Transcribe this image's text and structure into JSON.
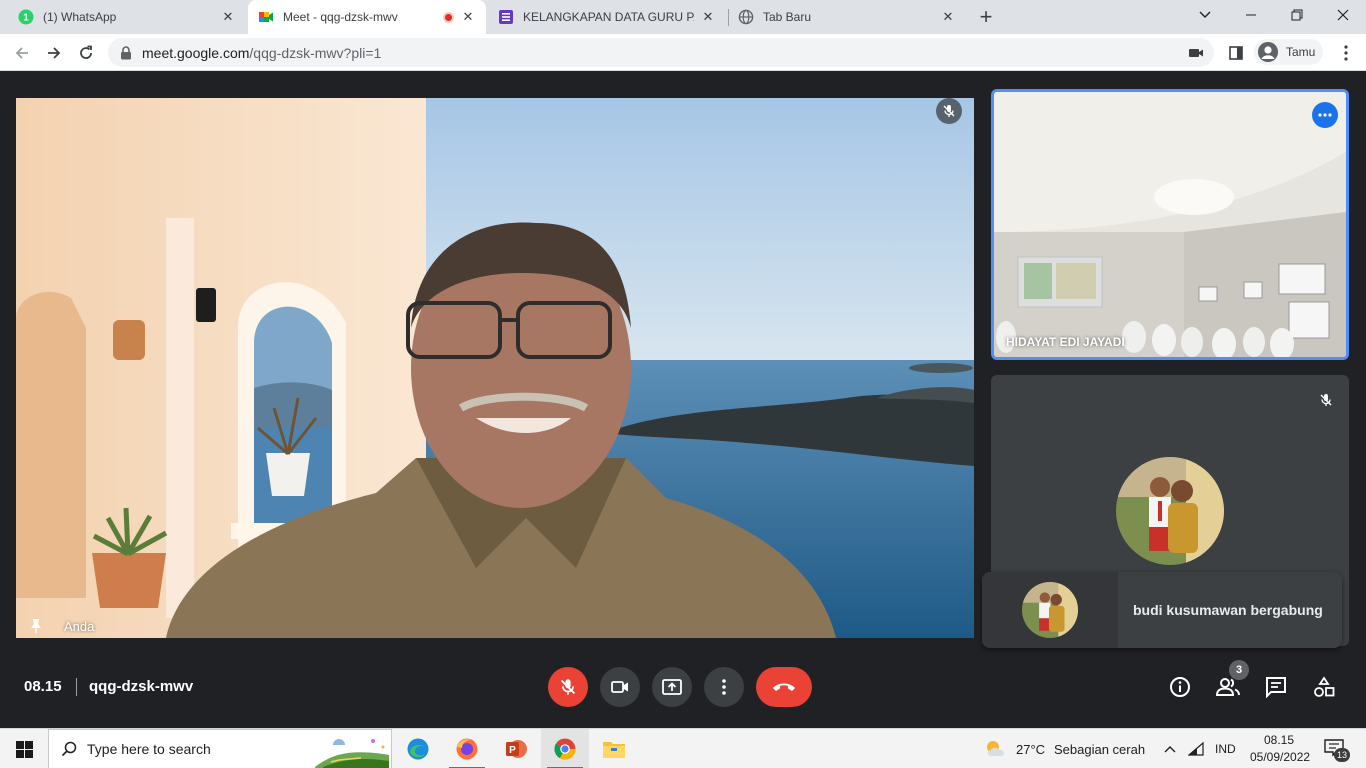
{
  "browser": {
    "tabs": [
      {
        "title": "(1) WhatsApp",
        "badge": "1",
        "icon": "whatsapp-icon"
      },
      {
        "title": "Meet - qqg-dzsk-mwv",
        "icon": "google-meet-icon",
        "recording": true
      },
      {
        "title": "KELANGKAPAN DATA GURU PAMO",
        "icon": "google-forms-icon"
      },
      {
        "title": "Tab Baru",
        "icon": "globe-icon"
      }
    ],
    "url_host": "meet.google.com",
    "url_path": "/qqg-dzsk-mwv?pli=1",
    "profile_label": "Tamu"
  },
  "meet": {
    "self_label": "Anda",
    "participants": [
      {
        "name": "HIDAYAT EDI JAYADI"
      },
      {
        "name": ""
      }
    ],
    "notification": "budi kusumawan bergabung",
    "time": "08.15",
    "meeting_code": "qqg-dzsk-mwv",
    "people_count": "3",
    "colors": {
      "accent": "#1a73e8",
      "danger": "#ea4335",
      "surface": "#3c4043",
      "background": "#202124"
    }
  },
  "taskbar": {
    "search_placeholder": "Type here to search",
    "weather_temp": "27°C",
    "weather_desc": "Sebagian cerah",
    "language": "IND",
    "clock_time": "08.15",
    "clock_date": "05/09/2022",
    "notification_count": "13"
  }
}
